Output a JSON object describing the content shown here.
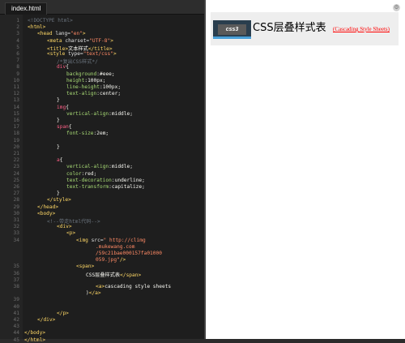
{
  "editor": {
    "tab_label": "index.html",
    "lines": [
      {
        "n": "1",
        "segs": [
          [
            "cmt",
            "<!DOCTYPE html>"
          ]
        ]
      },
      {
        "n": "2",
        "segs": [
          [
            "tag",
            "<html>"
          ]
        ]
      },
      {
        "n": "3",
        "segs": [
          [
            "tag",
            "<head "
          ],
          [
            "attr",
            "lang="
          ],
          [
            "str",
            "\"en\""
          ],
          [
            "tag",
            ">"
          ]
        ]
      },
      {
        "n": "4",
        "segs": [
          [
            "tag",
            "<meta "
          ],
          [
            "attr",
            "charset="
          ],
          [
            "str",
            "\"UTF-8\""
          ],
          [
            "tag",
            ">"
          ]
        ]
      },
      {
        "n": "5",
        "segs": [
          [
            "tag",
            "<title>"
          ],
          [
            "txt",
            "文本样式"
          ],
          [
            "tag",
            "</title>"
          ]
        ]
      },
      {
        "n": "6",
        "segs": [
          [
            "tag",
            "<style "
          ],
          [
            "attr",
            "type="
          ],
          [
            "str",
            "\"text/css\""
          ],
          [
            "tag",
            ">"
          ]
        ]
      },
      {
        "n": "7",
        "segs": [
          [
            "cmt",
            "/*复出CSS样式*/"
          ]
        ]
      },
      {
        "n": "8",
        "segs": [
          [
            "sel",
            "div"
          ],
          [
            "txt",
            "{"
          ]
        ]
      },
      {
        "n": "9",
        "segs": [
          [
            "prop",
            "background"
          ],
          [
            "txt",
            ":#eee;"
          ]
        ]
      },
      {
        "n": "10",
        "segs": [
          [
            "prop",
            "height"
          ],
          [
            "txt",
            ":100px;"
          ]
        ]
      },
      {
        "n": "11",
        "segs": [
          [
            "prop",
            "line-height"
          ],
          [
            "txt",
            ":100px;"
          ]
        ]
      },
      {
        "n": "12",
        "segs": [
          [
            "prop",
            "text-align"
          ],
          [
            "txt",
            ":center;"
          ]
        ]
      },
      {
        "n": "13",
        "segs": [
          [
            "txt",
            "}"
          ]
        ]
      },
      {
        "n": "14",
        "segs": [
          [
            "sel",
            "img"
          ],
          [
            "txt",
            "{"
          ]
        ]
      },
      {
        "n": "15",
        "segs": [
          [
            "prop",
            "vertical-align"
          ],
          [
            "txt",
            ":middle;"
          ]
        ]
      },
      {
        "n": "16",
        "segs": [
          [
            "txt",
            "}"
          ]
        ]
      },
      {
        "n": "17",
        "segs": [
          [
            "sel",
            "span"
          ],
          [
            "txt",
            "{"
          ]
        ]
      },
      {
        "n": "18",
        "segs": [
          [
            "prop",
            "font-size"
          ],
          [
            "txt",
            ":2em;"
          ]
        ]
      },
      {
        "n": "19",
        "segs": []
      },
      {
        "n": "20",
        "segs": [
          [
            "txt",
            "}"
          ]
        ]
      },
      {
        "n": "21",
        "segs": []
      },
      {
        "n": "22",
        "segs": [
          [
            "sel",
            "a"
          ],
          [
            "txt",
            "{"
          ]
        ]
      },
      {
        "n": "23",
        "segs": [
          [
            "prop",
            "vertical-align"
          ],
          [
            "txt",
            ":middle;"
          ]
        ]
      },
      {
        "n": "24",
        "segs": [
          [
            "prop",
            "color"
          ],
          [
            "txt",
            ":red;"
          ]
        ]
      },
      {
        "n": "25",
        "segs": [
          [
            "prop",
            "text-decoration"
          ],
          [
            "txt",
            ":underline;"
          ]
        ]
      },
      {
        "n": "26",
        "segs": [
          [
            "prop",
            "text-transform"
          ],
          [
            "txt",
            ":capitalize;"
          ]
        ]
      },
      {
        "n": "27",
        "segs": [
          [
            "txt",
            "}"
          ]
        ]
      },
      {
        "n": "28",
        "segs": [
          [
            "tag",
            "</style>"
          ]
        ]
      },
      {
        "n": "29",
        "segs": [
          [
            "tag",
            "</head>"
          ]
        ]
      },
      {
        "n": "30",
        "segs": [
          [
            "tag",
            "<body>"
          ]
        ]
      },
      {
        "n": "31",
        "segs": [
          [
            "cmt",
            "<!--带走html代码-->"
          ]
        ]
      },
      {
        "n": "32",
        "segs": [
          [
            "tag",
            "<div>"
          ]
        ]
      },
      {
        "n": "33",
        "segs": [
          [
            "tag",
            "<p>"
          ]
        ]
      },
      {
        "n": "34",
        "segs": [
          [
            "tag",
            "<img "
          ],
          [
            "attr",
            "src="
          ],
          [
            "str",
            "\" http://climg"
          ]
        ]
      },
      {
        "n": "",
        "segs": [
          [
            "str",
            ".mukewang.com"
          ]
        ]
      },
      {
        "n": "",
        "segs": [
          [
            "str",
            "/59c21bae000157fa01000"
          ]
        ]
      },
      {
        "n": "",
        "segs": [
          [
            "str",
            "059.jpg\""
          ],
          [
            "tag",
            "/>"
          ]
        ]
      },
      {
        "n": "35",
        "segs": [
          [
            "tag",
            "<span>"
          ]
        ]
      },
      {
        "n": "36",
        "segs": [
          [
            "txt",
            "CSS层叠样式表"
          ],
          [
            "tag",
            "</span>"
          ]
        ]
      },
      {
        "n": "37",
        "segs": []
      },
      {
        "n": "38",
        "segs": [
          [
            "tag",
            "<a>"
          ],
          [
            "txt",
            "cascading style sheets"
          ]
        ]
      },
      {
        "n": "",
        "segs": [
          [
            "txt",
            ")"
          ],
          [
            "tag",
            "</a>"
          ]
        ]
      },
      {
        "n": "39",
        "segs": []
      },
      {
        "n": "40",
        "segs": []
      },
      {
        "n": "41",
        "segs": [
          [
            "tag",
            "</p>"
          ]
        ]
      },
      {
        "n": "42",
        "segs": [
          [
            "tag",
            "</div>"
          ]
        ]
      },
      {
        "n": "43",
        "segs": []
      },
      {
        "n": "44",
        "segs": [
          [
            "tag",
            "</body>"
          ]
        ]
      },
      {
        "n": "45",
        "segs": [
          [
            "tag",
            "</html>"
          ]
        ]
      }
    ]
  },
  "preview": {
    "logo_text": "css3",
    "title": "CSS层叠样式表",
    "link_text": "(Cascading Style Sheets)"
  },
  "colors": {
    "link": "#ff0000",
    "editor_bg": "#1e1e1e",
    "demo_bg": "#eeeeee"
  }
}
